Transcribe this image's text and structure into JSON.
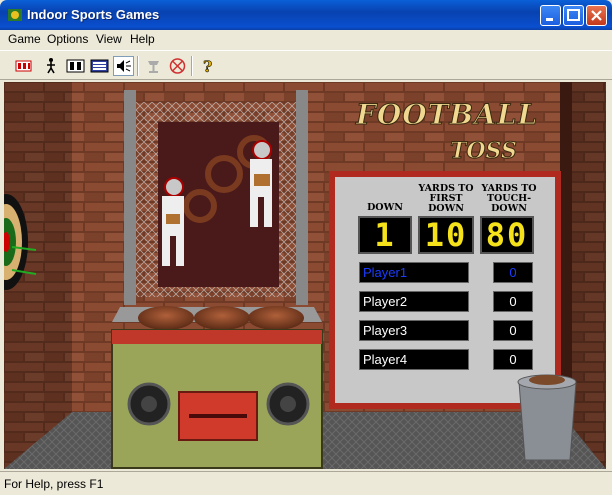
{
  "window": {
    "title": "Indoor Sports Games"
  },
  "menu": {
    "items": [
      "Game",
      "Options",
      "View",
      "Help"
    ]
  },
  "toolbar": {
    "buttons": [
      "scoreboard-icon",
      "player-icon",
      "two-player-icon",
      "keyboard-icon",
      "sound-icon",
      "trophy-icon",
      "no-entry-icon",
      "help-icon"
    ]
  },
  "game": {
    "logo_line1": "FOOTBALL",
    "logo_line2": "TOSS",
    "headers": {
      "down": "DOWN",
      "yards_first": "YARDS TO FIRST DOWN",
      "yards_td": "YARDS TO TOUCH-DOWN"
    },
    "down": "1",
    "yards_first": "10",
    "yards_td": "80",
    "players": [
      {
        "name": "Player1",
        "score": "0",
        "active": true
      },
      {
        "name": "Player2",
        "score": "0",
        "active": false
      },
      {
        "name": "Player3",
        "score": "0",
        "active": false
      },
      {
        "name": "Player4",
        "score": "0",
        "active": false
      }
    ]
  },
  "status": {
    "text": "For Help, press F1"
  },
  "colors": {
    "active_player": "#1a3cff",
    "display_digits": "#f5e21a",
    "title_bar": "#0842b0"
  }
}
